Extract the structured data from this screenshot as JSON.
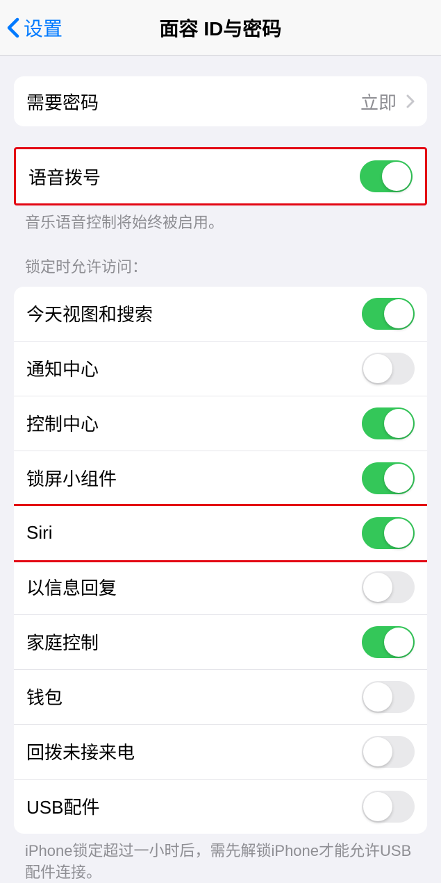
{
  "nav": {
    "back_label": "设置",
    "title": "面容 ID与密码"
  },
  "group1": {
    "require_passcode_label": "需要密码",
    "require_passcode_value": "立即"
  },
  "group2": {
    "voice_dial_label": "语音拨号",
    "voice_dial_on": true,
    "footer": "音乐语音控制将始终被启用。"
  },
  "group3": {
    "header": "锁定时允许访问：",
    "items": [
      {
        "label": "今天视图和搜索",
        "on": true,
        "highlighted": false
      },
      {
        "label": "通知中心",
        "on": false,
        "highlighted": false
      },
      {
        "label": "控制中心",
        "on": true,
        "highlighted": false
      },
      {
        "label": "锁屏小组件",
        "on": true,
        "highlighted": false
      },
      {
        "label": "Siri",
        "on": true,
        "highlighted": true
      },
      {
        "label": "以信息回复",
        "on": false,
        "highlighted": false
      },
      {
        "label": "家庭控制",
        "on": true,
        "highlighted": false
      },
      {
        "label": "钱包",
        "on": false,
        "highlighted": false
      },
      {
        "label": "回拨未接来电",
        "on": false,
        "highlighted": false
      },
      {
        "label": "USB配件",
        "on": false,
        "highlighted": false
      }
    ],
    "footer": "iPhone锁定超过一小时后，需先解锁iPhone才能允许USB配件连接。"
  }
}
